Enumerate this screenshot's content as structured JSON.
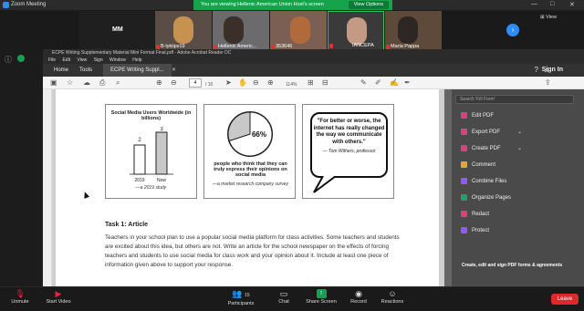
{
  "zoom": {
    "window_title": "Zoom Meeting",
    "banner_text": "You are viewing Hellenic American Union Host's screen",
    "view_options_label": "View Options",
    "view_label": "View",
    "participants": [
      {
        "name": "MM"
      },
      {
        "name": "B-lykiips19"
      },
      {
        "name": "Hellenic Americ..."
      },
      {
        "name": "353646"
      },
      {
        "name": "IANCEPA"
      },
      {
        "name": "Maria Pappa"
      }
    ],
    "bottom_bar": {
      "unmute": "Unmute",
      "start_video": "Start Video",
      "participants": "Participants",
      "participants_count": "15",
      "chat": "Chat",
      "share_screen": "Share Screen",
      "record": "Record",
      "reactions": "Reactions",
      "leave": "Leave"
    }
  },
  "acrobat": {
    "title": "ECPE Writing Supplementary Material Mini Format Final.pdf - Adobe Acrobat Reader DC",
    "menu": [
      "File",
      "Edit",
      "View",
      "Sign",
      "Window",
      "Help"
    ],
    "tabs": [
      "Home",
      "Tools",
      "ECPE Writing Suppl..."
    ],
    "sign_in": "Sign In",
    "toolbar": {
      "page_current": "4",
      "page_total": "/ 10",
      "zoom": "114%"
    },
    "tools_panel": [
      {
        "label": "Search 'Fill Form'",
        "color": "#777777"
      },
      {
        "label": "Edit PDF",
        "color": "#d9437d"
      },
      {
        "label": "Export PDF",
        "color": "#d9437d",
        "chevron": "⌄"
      },
      {
        "label": "Create PDF",
        "color": "#d9437d",
        "chevron": "⌄"
      },
      {
        "label": "Comment",
        "color": "#e8a23a"
      },
      {
        "label": "Combine Files",
        "color": "#8b5cf6"
      },
      {
        "label": "Organize Pages",
        "color": "#22a06b"
      },
      {
        "label": "Redact",
        "color": "#d9437d"
      },
      {
        "label": "Protect",
        "color": "#8b5cf6"
      }
    ],
    "promo_text": "Create, edit and sign PDF forms & agreements"
  },
  "document": {
    "panel1": {
      "title": "Social Media Users Worldwide (in billions)",
      "bar_values": [
        "2",
        "3"
      ],
      "bar_labels": [
        "2019",
        "Now"
      ],
      "source": "—a 2019 study"
    },
    "panel2": {
      "pie_value": "66%",
      "caption": "people who think that they can truly express their opinions on social media",
      "source": "—a market research company survey"
    },
    "panel3": {
      "quote": "\"For better or worse, the internet has really changed the way we communicate with others.\"",
      "attribution": "— Tom Withers, professor"
    },
    "task_title": "Task 1: Article",
    "task_body": "Teachers in your school plan to use a popular social media platform for class activities. Some teachers and students are excited about this idea, but others are not. Write an article for the school newspaper on the effects of forcing teachers and students to use social media for class work and your opinion about it. Include at least one piece of information given above to support your response."
  }
}
